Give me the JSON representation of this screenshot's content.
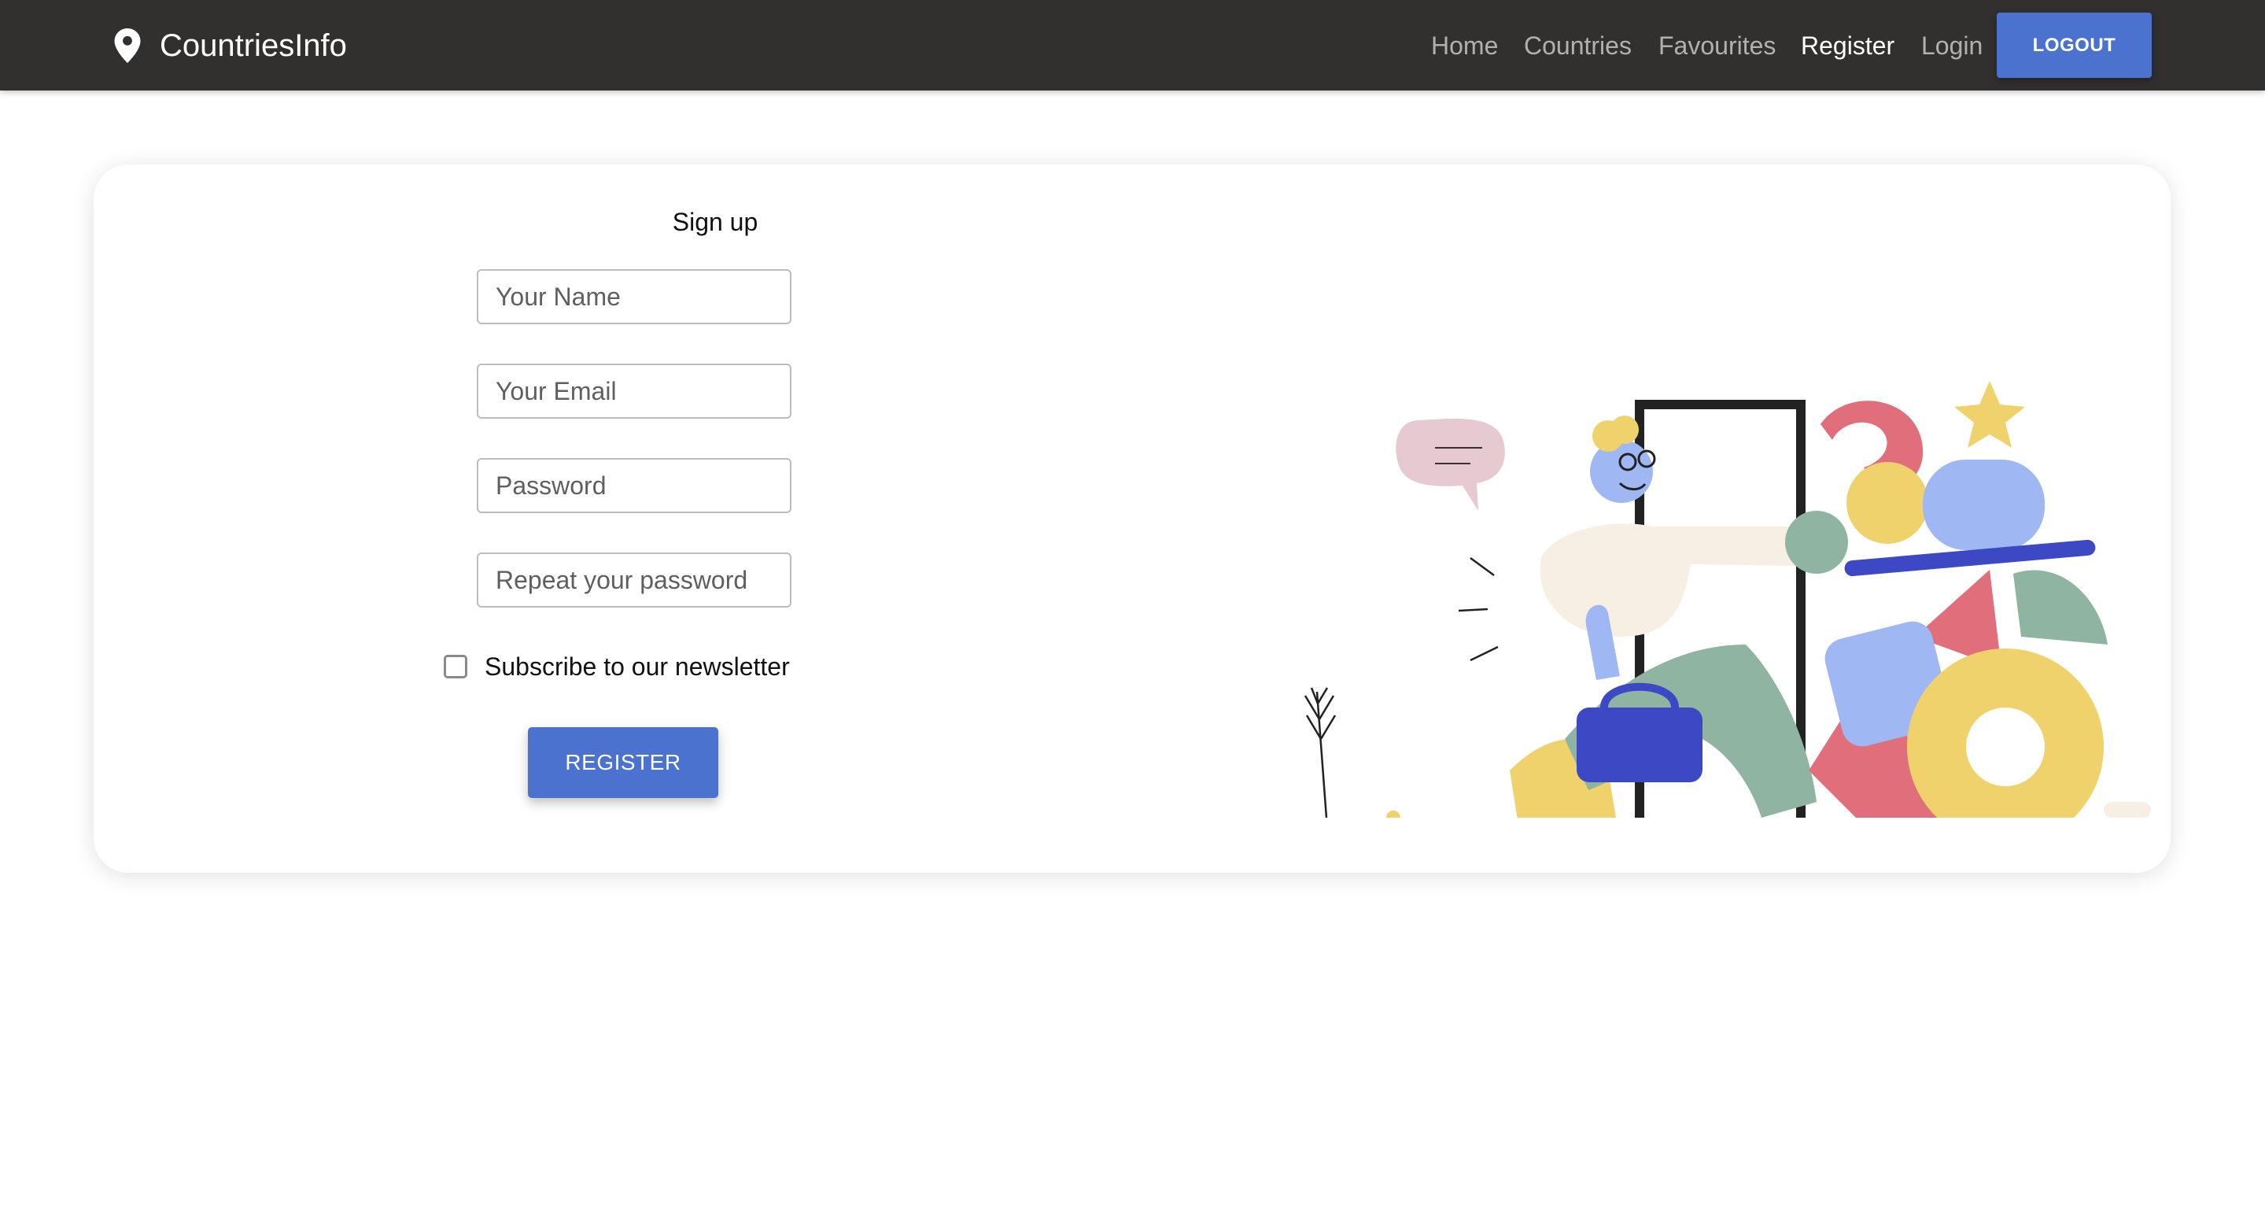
{
  "header": {
    "brand": "CountriesInfo",
    "brand_icon": "map-pin-icon",
    "nav": {
      "home": "Home",
      "countries": "Countries",
      "favourites": "Favourites",
      "register": "Register",
      "login": "Login"
    },
    "active_nav": "Register",
    "logout_label": "LOGOUT"
  },
  "form": {
    "title": "Sign up",
    "name_placeholder": "Your Name",
    "email_placeholder": "Your Email",
    "password_placeholder": "Password",
    "repeat_password_placeholder": "Repeat your password",
    "newsletter_label": "Subscribe to our newsletter",
    "newsletter_checked": false,
    "submit_label": "REGISTER"
  },
  "colors": {
    "navbar": "#322f2f",
    "accent": "#4a72ce",
    "background": "#ffffff"
  }
}
